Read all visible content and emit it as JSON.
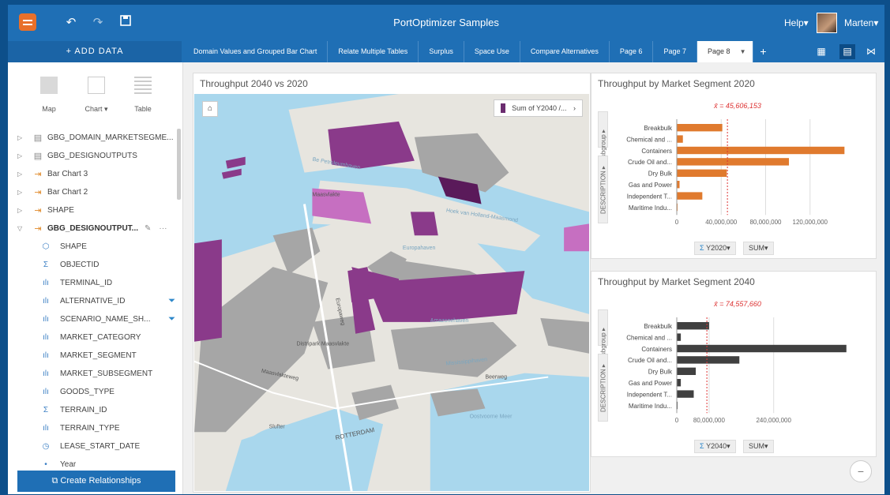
{
  "header": {
    "title": "PortOptimizer Samples",
    "help": "Help▾",
    "user": "Marten▾",
    "icons": [
      "app-logo",
      "undo-icon",
      "redo-icon",
      "save-icon"
    ]
  },
  "tabbar": {
    "add_data": "+ ADD DATA",
    "tabs": [
      "Domain Values and Grouped Bar Chart",
      "Relate Multiple Tables",
      "Surplus",
      "Space Use",
      "Compare Alternatives",
      "Page 6",
      "Page 7"
    ],
    "active_tab": "Page 8",
    "add_tab": "+"
  },
  "sidebar": {
    "viz_types": [
      {
        "label": "Map"
      },
      {
        "label": "Chart ▾"
      },
      {
        "label": "Table"
      }
    ],
    "datasets": [
      {
        "name": "GBG_DOMAIN_MARKETSEGME...",
        "icon": "table-icon"
      },
      {
        "name": "GBG_DESIGNOUTPUTS",
        "icon": "table-icon"
      },
      {
        "name": "Bar Chart 3",
        "icon": "result-icon"
      },
      {
        "name": "Bar Chart 2",
        "icon": "result-icon"
      },
      {
        "name": "SHAPE",
        "icon": "result-icon"
      },
      {
        "name": "GBG_DESIGNOUTPUT...",
        "icon": "result-icon"
      }
    ],
    "fields": [
      {
        "name": "SHAPE",
        "icon": "shape-icon",
        "filter": false
      },
      {
        "name": "OBJECTID",
        "icon": "sigma-icon",
        "filter": false
      },
      {
        "name": "TERMINAL_ID",
        "icon": "string-icon",
        "filter": false
      },
      {
        "name": "ALTERNATIVE_ID",
        "icon": "string-icon",
        "filter": true
      },
      {
        "name": "SCENARIO_NAME_SH...",
        "icon": "string-icon",
        "filter": true
      },
      {
        "name": "MARKET_CATEGORY",
        "icon": "string-icon",
        "filter": false
      },
      {
        "name": "MARKET_SEGMENT",
        "icon": "string-icon",
        "filter": false
      },
      {
        "name": "MARKET_SUBSEGMENT",
        "icon": "string-icon",
        "filter": false
      },
      {
        "name": "GOODS_TYPE",
        "icon": "string-icon",
        "filter": false
      },
      {
        "name": "TERRAIN_ID",
        "icon": "sigma-icon",
        "filter": false
      },
      {
        "name": "TERRAIN_TYPE",
        "icon": "string-icon",
        "filter": false
      },
      {
        "name": "LEASE_START_DATE",
        "icon": "clock-icon",
        "filter": false
      },
      {
        "name": "Year",
        "icon": "dot-icon",
        "filter": false
      }
    ],
    "create_relationships": "Create Relationships"
  },
  "map_card": {
    "title": "Throughput 2040 vs 2020",
    "legend_label": "Sum of Y2040 /...",
    "labels": [
      "Be Petroleumhaven",
      "Maasvlakte",
      "Amazonehaven",
      "Europahaven",
      "Hoek van Holland-Maasmond",
      "Distripark Maasvlakte",
      "Maasvlakteweg",
      "Europaweg",
      "Beerweg",
      "Slufter",
      "ROTTERDAM",
      "Oostvoorne Meer",
      "Mississippihaven"
    ]
  },
  "chart_data": [
    {
      "type": "bar",
      "title": "Throughput by Market Segment 2020",
      "categories": [
        "Breakbulk",
        "Chemical and ...",
        "Containers",
        "Crude Oil and...",
        "Dry Bulk",
        "Gas and Power",
        "Independent T...",
        "Maritime Indu..."
      ],
      "values": [
        41000000,
        5500000,
        151000000,
        101000000,
        45000000,
        2500000,
        23000000,
        300000
      ],
      "mean_label": "x̄ = 45,606,153",
      "mean": 45606153,
      "xticks": [
        "0",
        "40,000,000",
        "80,000,000",
        "120,000,000"
      ],
      "xlim": [
        0,
        160000000
      ],
      "color": "#e07a2e",
      "measure": "Y2020▾",
      "stat": "SUM▾",
      "axis_tabs": [
        "Subgroup ▸",
        "DESCRIPTION ▸"
      ]
    },
    {
      "type": "bar",
      "title": "Throughput by Market Segment 2040",
      "categories": [
        "Breakbulk",
        "Chemical and ...",
        "Containers",
        "Crude Oil and...",
        "Dry Bulk",
        "Gas and Power",
        "Independent T...",
        "Maritime Indu..."
      ],
      "values": [
        80000000,
        10000000,
        420000000,
        155000000,
        47000000,
        10000000,
        42000000,
        1000000
      ],
      "mean_label": "x̄ = 74,557,660",
      "mean": 74557660,
      "xticks": [
        "0",
        "80,000,000",
        "240,000,000"
      ],
      "xlim": [
        0,
        440000000
      ],
      "color": "#404040",
      "measure": "Y2040▾",
      "stat": "SUM▾",
      "axis_tabs": [
        "Subgroup ▸",
        "DESCRIPTION ▸"
      ]
    }
  ]
}
